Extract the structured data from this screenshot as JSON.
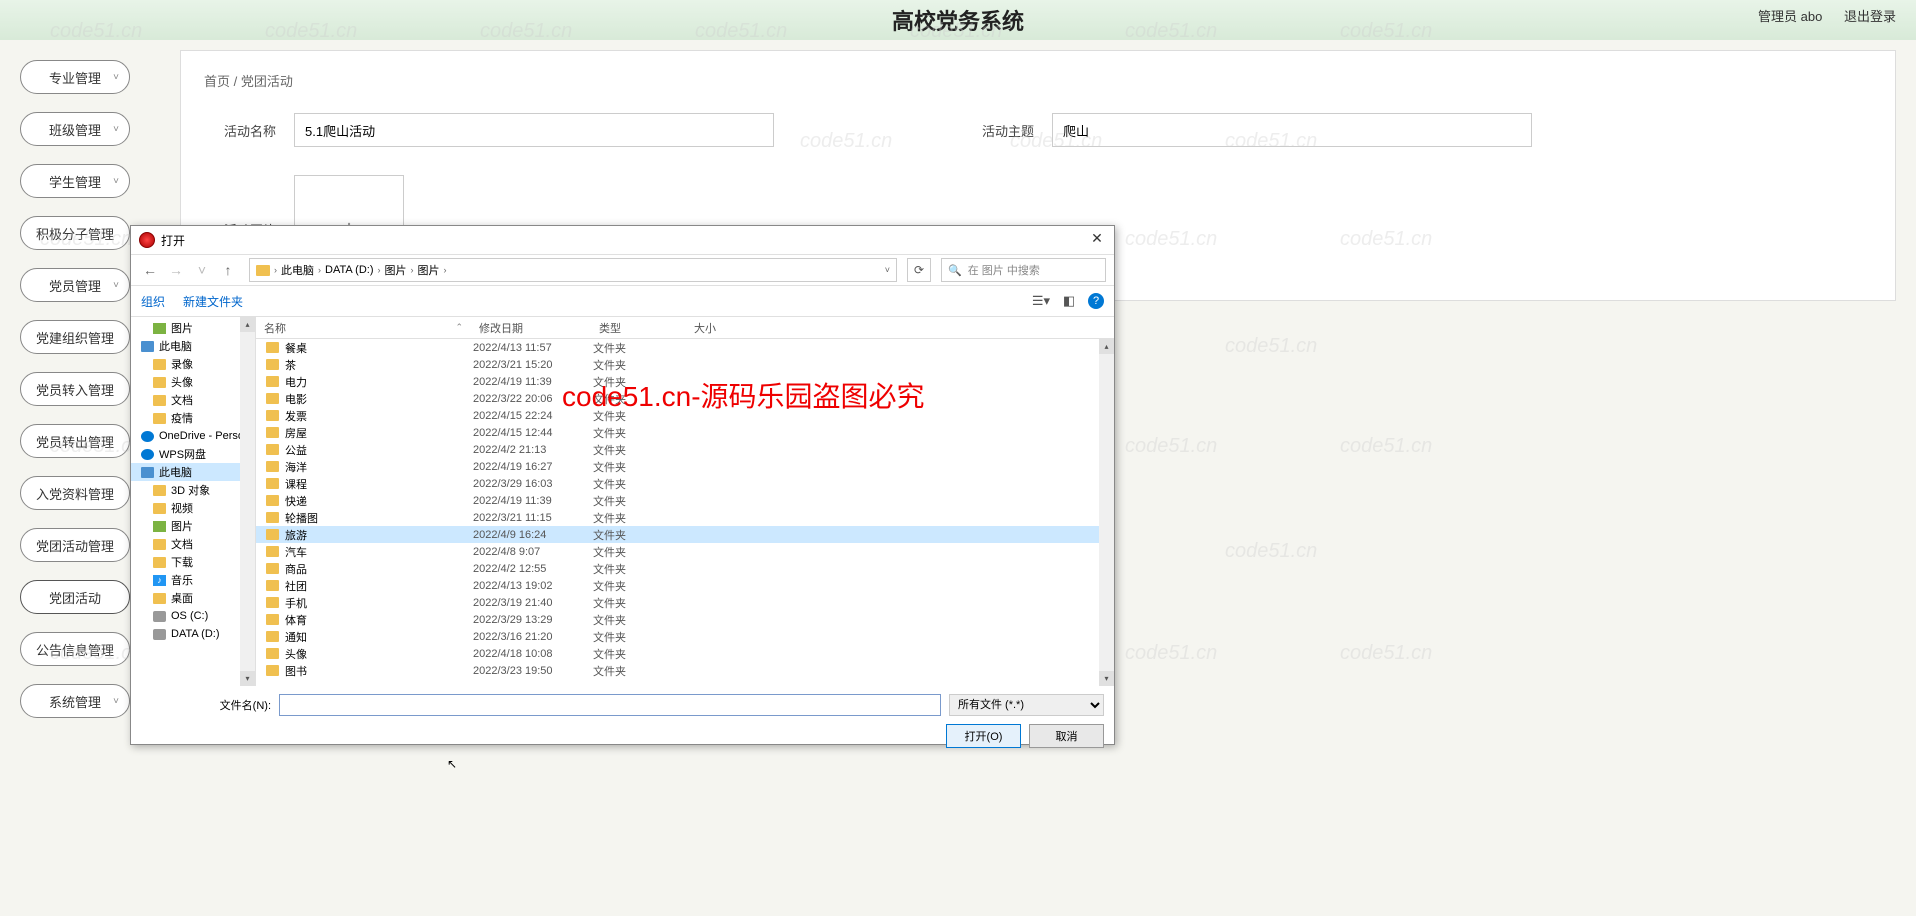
{
  "header": {
    "title": "高校党务系统",
    "admin": "管理员 abo",
    "logout": "退出登录"
  },
  "breadcrumb": {
    "home": "首页",
    "sep": "/",
    "current": "党团活动"
  },
  "sidebar": {
    "items": [
      {
        "label": "专业管理",
        "caret": true
      },
      {
        "label": "班级管理",
        "caret": true
      },
      {
        "label": "学生管理",
        "caret": true
      },
      {
        "label": "积极分子管理",
        "caret": false
      },
      {
        "label": "党员管理",
        "caret": true
      },
      {
        "label": "党建组织管理",
        "caret": false
      },
      {
        "label": "党员转入管理",
        "caret": false
      },
      {
        "label": "党员转出管理",
        "caret": false
      },
      {
        "label": "入党资料管理",
        "caret": false
      },
      {
        "label": "党团活动管理",
        "caret": false
      },
      {
        "label": "党团活动",
        "caret": false,
        "active": true
      },
      {
        "label": "公告信息管理",
        "caret": false
      },
      {
        "label": "系统管理",
        "caret": true
      }
    ]
  },
  "form": {
    "name_label": "活动名称",
    "name_value": "5.1爬山活动",
    "theme_label": "活动主题",
    "theme_value": "爬山",
    "image_label": "活动图片"
  },
  "dialog": {
    "title": "打开",
    "path": [
      "此电脑",
      "DATA (D:)",
      "图片",
      "图片"
    ],
    "search_ph": "在 图片 中搜索",
    "organize": "组织",
    "newfolder": "新建文件夹",
    "columns": {
      "name": "名称",
      "date": "修改日期",
      "type": "类型",
      "size": "大小"
    },
    "tree": [
      {
        "label": "图片",
        "icon": "pic",
        "indent": true
      },
      {
        "label": "此电脑",
        "icon": "pc",
        "indent": false
      },
      {
        "label": "录像",
        "icon": "folder",
        "indent": true
      },
      {
        "label": "头像",
        "icon": "folder",
        "indent": true
      },
      {
        "label": "文档",
        "icon": "folder",
        "indent": true
      },
      {
        "label": "疫情",
        "icon": "folder",
        "indent": true
      },
      {
        "label": "OneDrive - Perso",
        "icon": "cloud",
        "indent": false
      },
      {
        "label": "WPS网盘",
        "icon": "cloud",
        "indent": false
      },
      {
        "label": "此电脑",
        "icon": "pc",
        "indent": false,
        "selected": true
      },
      {
        "label": "3D 对象",
        "icon": "folder",
        "indent": true
      },
      {
        "label": "视频",
        "icon": "folder",
        "indent": true
      },
      {
        "label": "图片",
        "icon": "pic",
        "indent": true
      },
      {
        "label": "文档",
        "icon": "folder",
        "indent": true
      },
      {
        "label": "下载",
        "icon": "folder",
        "indent": true
      },
      {
        "label": "音乐",
        "icon": "music",
        "indent": true
      },
      {
        "label": "桌面",
        "icon": "folder",
        "indent": true
      },
      {
        "label": "OS (C:)",
        "icon": "disk",
        "indent": true
      },
      {
        "label": "DATA (D:)",
        "icon": "disk",
        "indent": true
      }
    ],
    "files": [
      {
        "name": "餐桌",
        "date": "2022/4/13 11:57",
        "type": "文件夹"
      },
      {
        "name": "茶",
        "date": "2022/3/21 15:20",
        "type": "文件夹"
      },
      {
        "name": "电力",
        "date": "2022/4/19 11:39",
        "type": "文件夹"
      },
      {
        "name": "电影",
        "date": "2022/3/22 20:06",
        "type": "文件夹"
      },
      {
        "name": "发票",
        "date": "2022/4/15 22:24",
        "type": "文件夹"
      },
      {
        "name": "房屋",
        "date": "2022/4/15 12:44",
        "type": "文件夹"
      },
      {
        "name": "公益",
        "date": "2022/4/2 21:13",
        "type": "文件夹"
      },
      {
        "name": "海洋",
        "date": "2022/4/19 16:27",
        "type": "文件夹"
      },
      {
        "name": "课程",
        "date": "2022/3/29 16:03",
        "type": "文件夹"
      },
      {
        "name": "快递",
        "date": "2022/4/19 11:39",
        "type": "文件夹"
      },
      {
        "name": "轮播图",
        "date": "2022/3/21 11:15",
        "type": "文件夹"
      },
      {
        "name": "旅游",
        "date": "2022/4/9 16:24",
        "type": "文件夹",
        "sel": true
      },
      {
        "name": "汽车",
        "date": "2022/4/8 9:07",
        "type": "文件夹"
      },
      {
        "name": "商品",
        "date": "2022/4/2 12:55",
        "type": "文件夹"
      },
      {
        "name": "社团",
        "date": "2022/4/13 19:02",
        "type": "文件夹"
      },
      {
        "name": "手机",
        "date": "2022/3/19 21:40",
        "type": "文件夹"
      },
      {
        "name": "体育",
        "date": "2022/3/29 13:29",
        "type": "文件夹"
      },
      {
        "name": "通知",
        "date": "2022/3/16 21:20",
        "type": "文件夹"
      },
      {
        "name": "头像",
        "date": "2022/4/18 10:08",
        "type": "文件夹"
      },
      {
        "name": "图书",
        "date": "2022/3/23 19:50",
        "type": "文件夹"
      }
    ],
    "filename_label": "文件名(N):",
    "filename_value": "",
    "filter": "所有文件 (*.*)",
    "open": "打开(O)",
    "cancel": "取消"
  },
  "watermark": {
    "text": "code51.cn",
    "red": "code51.cn-源码乐园盗图必究"
  }
}
